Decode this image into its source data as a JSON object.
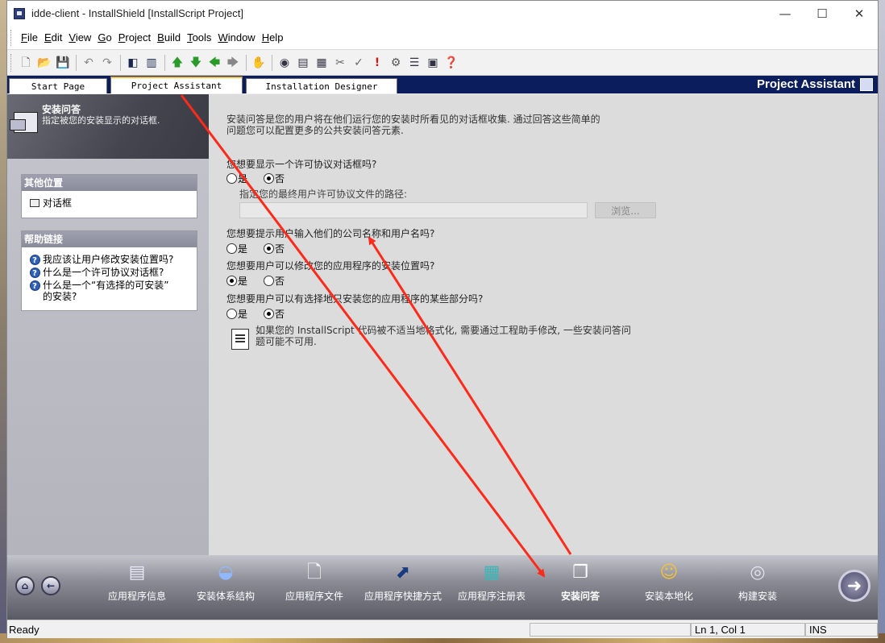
{
  "window": {
    "title": "idde-client - InstallShield [InstallScript Project]",
    "minimize": "—",
    "maximize": "☐",
    "close": "✕"
  },
  "menu": [
    "File",
    "Edit",
    "View",
    "Go",
    "Project",
    "Build",
    "Tools",
    "Window",
    "Help"
  ],
  "tabs": {
    "start_page": "Start Page",
    "project_assistant": "Project Assistant",
    "installation_designer": "Installation Designer",
    "header_title": "Project Assistant"
  },
  "left_pane": {
    "title": "安装问答",
    "subtitle": "指定被您的安装显示的对话框.",
    "other_locations_header": "其他位置",
    "other_locations": [
      "对话框"
    ],
    "help_links_header": "帮助链接",
    "help_links": [
      "我应该让用户修改安装位置吗?",
      "什么是一个许可协议对话框?",
      "什么是一个“有选择的可安装”",
      "的安装?"
    ]
  },
  "main": {
    "intro_line1": "安装问答是您的用户将在他们运行您的安装时所看见的对话框收集. 通过回答这些简单的",
    "intro_line2": "问题您可以配置更多的公共安装问答元素.",
    "q1": "您想要显示一个许可协议对话框吗?",
    "yes": "是",
    "no": "否",
    "path_label": "指定您的最终用户许可协议文件的路径:",
    "path_value": "",
    "browse": "浏览...",
    "q2": "您想要提示用户输入他们的公司名称和用户名吗?",
    "q3": "您想要用户可以修改您的应用程序的安装位置吗?",
    "q4": "您想要用户可以有选择地只安装您的应用程序的某些部分吗?",
    "answers": {
      "q1": "否",
      "q2": "否",
      "q3": "是",
      "q4": "否"
    },
    "note_line1": "如果您的 InstallScript 代码被不适当地格式化, 需要通过工程助手修改, 一些安装问答问",
    "note_line2": "题可能不可用."
  },
  "bottom_nav": [
    {
      "label": "应用程序信息",
      "icon": "app-info-icon"
    },
    {
      "label": "安装体系结构",
      "icon": "architecture-icon"
    },
    {
      "label": "应用程序文件",
      "icon": "app-files-icon"
    },
    {
      "label": "应用程序快捷方式",
      "icon": "shortcut-icon"
    },
    {
      "label": "应用程序注册表",
      "icon": "registry-icon"
    },
    {
      "label": "安装问答",
      "icon": "interview-icon",
      "active": true
    },
    {
      "label": "安装本地化",
      "icon": "localization-icon"
    },
    {
      "label": "构建安装",
      "icon": "build-icon"
    }
  ],
  "status": {
    "ready": "Ready",
    "position": "Ln 1, Col 1",
    "mode": "INS"
  },
  "colors": {
    "tab_bar": "#0b1d5c",
    "annotation_arrows": "#ff2a1a"
  }
}
